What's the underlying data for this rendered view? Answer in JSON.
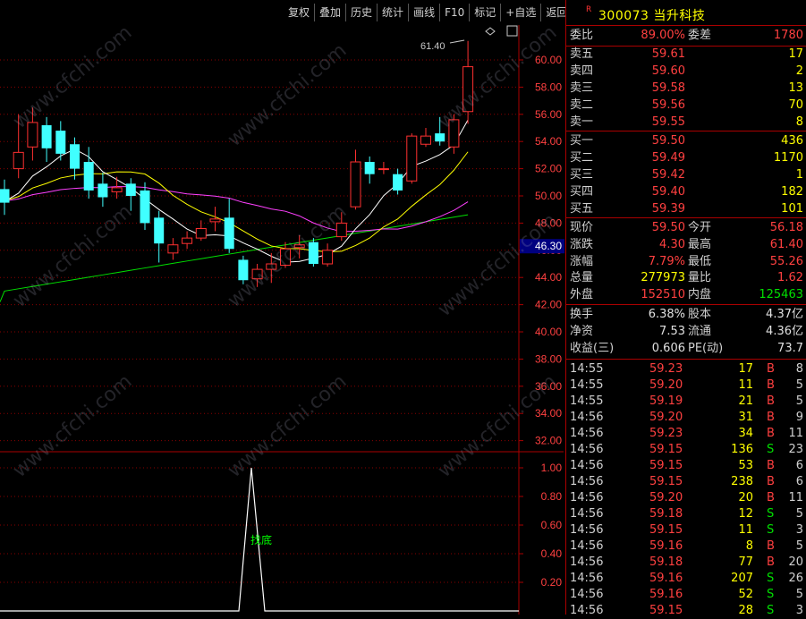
{
  "toolbar": {
    "buttons": [
      "复权",
      "叠加",
      "历史",
      "统计",
      "画线",
      "F10",
      "标记",
      "+自选",
      "返回"
    ]
  },
  "chart": {
    "price_axis_labels": [
      "60.00",
      "58.00",
      "56.00",
      "54.00",
      "52.00",
      "50.00",
      "48.00",
      "46.00",
      "44.00",
      "42.00",
      "40.00",
      "38.00",
      "36.00",
      "34.00",
      "32.00"
    ],
    "current_price_tag": "46.30",
    "high_annotation": "61.40",
    "indicator_axis_labels": [
      "1.00",
      "0.80",
      "0.60",
      "0.40",
      "0.20"
    ],
    "signal_label": "找底",
    "watermark": "www.cfchi.com",
    "colors": {
      "up": "#ff3030",
      "down": "#40ffff",
      "ma5": "#ffffff",
      "ma10": "#ffff00",
      "ma20": "#ff40ff",
      "ma60": "#00e000",
      "grid": "#8a0000"
    }
  },
  "stock": {
    "r_mark": "R",
    "code": "300073",
    "name": "当升科技"
  },
  "order_book": {
    "weibi_label": "委比",
    "weibi": "89.00%",
    "weicha_label": "委差",
    "weicha": "1780",
    "asks": [
      {
        "label": "卖五",
        "price": "59.61",
        "vol": "17"
      },
      {
        "label": "卖四",
        "price": "59.60",
        "vol": "2"
      },
      {
        "label": "卖三",
        "price": "59.58",
        "vol": "13"
      },
      {
        "label": "卖二",
        "price": "59.56",
        "vol": "70"
      },
      {
        "label": "卖一",
        "price": "59.55",
        "vol": "8"
      }
    ],
    "bids": [
      {
        "label": "买一",
        "price": "59.50",
        "vol": "436"
      },
      {
        "label": "买二",
        "price": "59.49",
        "vol": "1170"
      },
      {
        "label": "买三",
        "price": "59.42",
        "vol": "1"
      },
      {
        "label": "买四",
        "price": "59.40",
        "vol": "182"
      },
      {
        "label": "买五",
        "price": "59.39",
        "vol": "101"
      }
    ]
  },
  "quote": {
    "rows": [
      {
        "l1": "现价",
        "v1": "59.50",
        "c1": "red",
        "l2": "今开",
        "v2": "56.18",
        "c2": "red"
      },
      {
        "l1": "涨跌",
        "v1": "4.30",
        "c1": "red",
        "l2": "最高",
        "v2": "61.40",
        "c2": "red"
      },
      {
        "l1": "涨幅",
        "v1": "7.79%",
        "c1": "red",
        "l2": "最低",
        "v2": "55.26",
        "c2": "red"
      },
      {
        "l1": "总量",
        "v1": "277973",
        "c1": "yellow",
        "l2": "量比",
        "v2": "1.62",
        "c2": "red"
      },
      {
        "l1": "外盘",
        "v1": "152510",
        "c1": "red",
        "l2": "内盘",
        "v2": "125463",
        "c2": "green"
      }
    ],
    "fund_rows": [
      {
        "l1": "换手",
        "v1": "6.38%",
        "l2": "股本",
        "v2": "4.37亿"
      },
      {
        "l1": "净资",
        "v1": "7.53",
        "l2": "流通",
        "v2": "4.36亿"
      },
      {
        "l1": "收益(三)",
        "v1": "0.606",
        "l2": "PE(动)",
        "v2": "73.7"
      }
    ]
  },
  "ticks": [
    {
      "time": "14:55",
      "price": "59.23",
      "vol": "17",
      "bs": "B",
      "n": "8"
    },
    {
      "time": "14:55",
      "price": "59.20",
      "vol": "11",
      "bs": "B",
      "n": "5"
    },
    {
      "time": "14:55",
      "price": "59.19",
      "vol": "21",
      "bs": "B",
      "n": "5"
    },
    {
      "time": "14:56",
      "price": "59.20",
      "vol": "31",
      "bs": "B",
      "n": "9"
    },
    {
      "time": "14:56",
      "price": "59.23",
      "vol": "34",
      "bs": "B",
      "n": "11"
    },
    {
      "time": "14:56",
      "price": "59.15",
      "vol": "136",
      "bs": "S",
      "n": "23"
    },
    {
      "time": "14:56",
      "price": "59.15",
      "vol": "53",
      "bs": "B",
      "n": "6"
    },
    {
      "time": "14:56",
      "price": "59.15",
      "vol": "238",
      "bs": "B",
      "n": "6"
    },
    {
      "time": "14:56",
      "price": "59.20",
      "vol": "20",
      "bs": "B",
      "n": "11"
    },
    {
      "time": "14:56",
      "price": "59.18",
      "vol": "12",
      "bs": "S",
      "n": "5"
    },
    {
      "time": "14:56",
      "price": "59.15",
      "vol": "11",
      "bs": "S",
      "n": "3"
    },
    {
      "time": "14:56",
      "price": "59.16",
      "vol": "8",
      "bs": "B",
      "n": "5"
    },
    {
      "time": "14:56",
      "price": "59.18",
      "vol": "77",
      "bs": "B",
      "n": "20"
    },
    {
      "time": "14:56",
      "price": "59.16",
      "vol": "207",
      "bs": "S",
      "n": "26"
    },
    {
      "time": "14:56",
      "price": "59.16",
      "vol": "52",
      "bs": "S",
      "n": "5"
    },
    {
      "time": "14:56",
      "price": "59.15",
      "vol": "28",
      "bs": "S",
      "n": "3"
    }
  ],
  "candles": [
    {
      "o": 50.5,
      "c": 49.5,
      "h": 51.2,
      "l": 48.6
    },
    {
      "o": 52.0,
      "c": 53.2,
      "h": 56.0,
      "l": 51.3
    },
    {
      "o": 53.6,
      "c": 55.4,
      "h": 56.5,
      "l": 52.6
    },
    {
      "o": 55.2,
      "c": 53.5,
      "h": 55.8,
      "l": 52.5
    },
    {
      "o": 54.8,
      "c": 53.1,
      "h": 55.5,
      "l": 52.6
    },
    {
      "o": 53.8,
      "c": 52.0,
      "h": 54.3,
      "l": 51.2
    },
    {
      "o": 52.5,
      "c": 50.4,
      "h": 53.6,
      "l": 49.8
    },
    {
      "o": 50.9,
      "c": 49.9,
      "h": 51.7,
      "l": 49.2
    },
    {
      "o": 50.3,
      "c": 50.6,
      "h": 51.4,
      "l": 49.8
    },
    {
      "o": 50.9,
      "c": 50.0,
      "h": 51.3,
      "l": 48.9
    },
    {
      "o": 50.4,
      "c": 48.0,
      "h": 51.0,
      "l": 47.5
    },
    {
      "o": 48.4,
      "c": 46.5,
      "h": 48.9,
      "l": 45.1
    },
    {
      "o": 45.8,
      "c": 46.4,
      "h": 46.9,
      "l": 45.3
    },
    {
      "o": 46.5,
      "c": 46.9,
      "h": 47.4,
      "l": 46.1
    },
    {
      "o": 46.9,
      "c": 47.6,
      "h": 48.2,
      "l": 46.7
    },
    {
      "o": 48.1,
      "c": 48.3,
      "h": 49.2,
      "l": 47.4
    },
    {
      "o": 48.4,
      "c": 46.1,
      "h": 49.8,
      "l": 45.8
    },
    {
      "o": 45.3,
      "c": 43.8,
      "h": 45.6,
      "l": 43.5
    },
    {
      "o": 43.9,
      "c": 44.6,
      "h": 45.0,
      "l": 43.3
    },
    {
      "o": 44.6,
      "c": 45.0,
      "h": 45.8,
      "l": 43.6
    },
    {
      "o": 44.9,
      "c": 46.1,
      "h": 46.6,
      "l": 44.7
    },
    {
      "o": 46.2,
      "c": 46.4,
      "h": 47.1,
      "l": 45.4
    },
    {
      "o": 46.6,
      "c": 45.0,
      "h": 46.9,
      "l": 44.8
    },
    {
      "o": 45.0,
      "c": 46.0,
      "h": 46.5,
      "l": 44.8
    },
    {
      "o": 47.0,
      "c": 48.0,
      "h": 48.8,
      "l": 46.7
    },
    {
      "o": 49.2,
      "c": 52.5,
      "h": 53.4,
      "l": 49.0
    },
    {
      "o": 52.5,
      "c": 51.6,
      "h": 52.9,
      "l": 50.9
    },
    {
      "o": 52.0,
      "c": 52.0,
      "h": 52.5,
      "l": 51.6
    },
    {
      "o": 51.6,
      "c": 50.4,
      "h": 52.0,
      "l": 50.1
    },
    {
      "o": 51.1,
      "c": 54.4,
      "h": 54.6,
      "l": 50.9
    },
    {
      "o": 53.8,
      "c": 54.4,
      "h": 55.0,
      "l": 53.6
    },
    {
      "o": 54.6,
      "c": 54.0,
      "h": 55.8,
      "l": 53.7
    },
    {
      "o": 53.6,
      "c": 55.6,
      "h": 56.0,
      "l": 53.1
    },
    {
      "o": 56.2,
      "c": 59.5,
      "h": 61.4,
      "l": 55.3
    }
  ]
}
